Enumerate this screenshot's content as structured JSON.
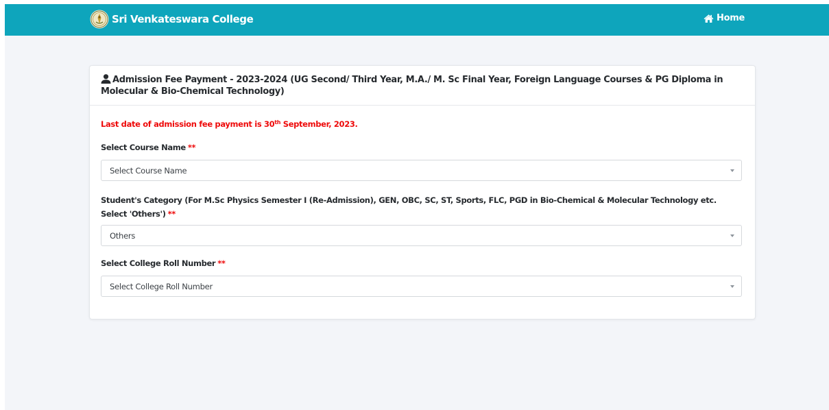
{
  "navbar": {
    "brand_name": "Sri Venkateswara College",
    "logo_icon": "college-emblem-icon",
    "home_label": "Home",
    "home_icon": "home-icon",
    "background_color": "#0ea5bc"
  },
  "card": {
    "title": "Admission Fee Payment - 2023-2024 (UG Second/ Third Year, M.A./ M. Sc Final Year, Foreign Language Courses & PG Diploma in Molecular & Bio-Chemical Technology)",
    "title_icon": "user-icon",
    "notice": {
      "prefix": "Last date of admission fee payment is 30",
      "superscript": "th",
      "suffix": " September, 2023.",
      "color": "#ee0a0a"
    },
    "required_marker": "**",
    "fields": [
      {
        "label": "Select Course Name",
        "value": "Select Course Name"
      },
      {
        "label": "Student's Category (For M.Sc Physics Semester I (Re-Admission), GEN, OBC, SC, ST, Sports, FLC, PGD in Bio-Chemical & Molecular Technology etc. Select 'Others')",
        "value": "Others"
      },
      {
        "label": "Select College Roll Number",
        "value": "Select College Roll Number"
      }
    ]
  }
}
